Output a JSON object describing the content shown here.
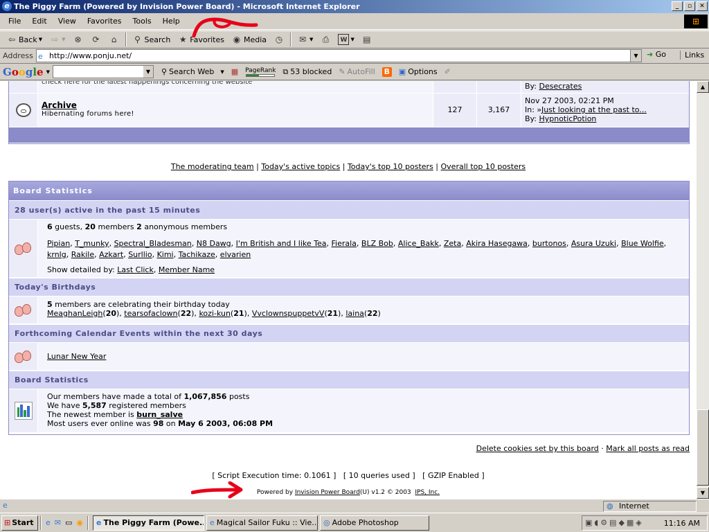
{
  "window": {
    "title": "The Piggy Farm (Powered by Invision Power Board) - Microsoft Internet Explorer",
    "minimize": "_",
    "maximize": "▫",
    "close": "✕"
  },
  "menu": [
    "File",
    "Edit",
    "View",
    "Favorites",
    "Tools",
    "Help"
  ],
  "toolbar": {
    "back": "Back",
    "search": "Search",
    "favorites": "Favorites",
    "media": "Media"
  },
  "address": {
    "label": "Address",
    "url": "http://www.ponju.net/",
    "go": "Go",
    "links": "Links"
  },
  "google_bar": {
    "logo": "Google",
    "search_web": "Search Web",
    "pagerank": "PageRank",
    "blocked": "53 blocked",
    "autofill": "AutoFill",
    "options": "Options"
  },
  "forum_top": {
    "cut_text": "check here for the latest happenings concerning the website",
    "by_label": "By:",
    "by_user": "Desecrates"
  },
  "archive": {
    "title": "Archive",
    "desc": "Hibernating forums here!",
    "topics": "127",
    "replies": "3,167",
    "date": "Nov 27 2003, 02:21 PM",
    "in_label": "In:",
    "in_topic": "Just looking at the past to...",
    "by_label": "By:",
    "by_user": "HypnoticPotion"
  },
  "center_links": {
    "moderating": "The moderating team",
    "active": "Today's active topics",
    "top_today": "Today's top 10 posters",
    "top_overall": "Overall top 10 posters",
    "sep": "|"
  },
  "stats": {
    "header": "Board Statistics",
    "active_head": "28 user(s) active in the past 15 minutes",
    "guests_n": "6",
    "guests_t": " guests, ",
    "members_n": "20",
    "members_t": " members ",
    "anon_n": "2",
    "anon_t": " anonymous members",
    "users": [
      "Pipian",
      "T_munky",
      "Spectral_Bladesman",
      "N8 Dawg",
      "I'm British and I like Tea",
      "Fierala",
      "BLZ Bob",
      "Alice_Bakk",
      "Zeta",
      "Akira Hasegawa",
      "burtonos",
      "Asura Uzuki",
      "Blue Wolfie",
      "krnlg",
      "Rakile",
      "Azkart",
      "Surllio",
      "Kimi",
      "Tachikaze",
      "elvarien"
    ],
    "detail_label": "Show detailed by: ",
    "last_click": "Last Click",
    "member_name": "Member Name",
    "birthday_head": "Today's Birthdays",
    "bday_n": "5",
    "bday_t": " members are celebrating their birthday today",
    "bdays": [
      {
        "name": "MeaghanLeigh",
        "age": "20"
      },
      {
        "name": "tearsofaclown",
        "age": "22"
      },
      {
        "name": "kozi-kun",
        "age": "21"
      },
      {
        "name": "VvclownspuppetvV",
        "age": "21"
      },
      {
        "name": "laina",
        "age": "22"
      }
    ],
    "calendar_head": "Forthcoming Calendar Events within the next 30 days",
    "event": "Lunar New Year",
    "board_head": "Board Statistics",
    "line1_a": "Our members have made a total of ",
    "line1_b": "1,067,856",
    "line1_c": " posts",
    "line2_a": "We have ",
    "line2_b": "5,587",
    "line2_c": " registered members",
    "line3_a": "The newest member is ",
    "line3_b": "burn_salve",
    "line4_a": "Most users ever online was ",
    "line4_b": "98",
    "line4_c": " on ",
    "line4_d": "May 6 2003, 06:08 PM"
  },
  "bottom": {
    "delete_cookies": "Delete cookies set by this board",
    "dot": " · ",
    "mark_read": "Mark all posts as read",
    "exec": "[ Script Execution time: 0.1061 ]   [ 10 queries used ]   [ GZIP Enabled ]",
    "powered_a": "Powered by ",
    "powered_link": "Invision Power Board",
    "powered_b": "(U) v1.2 © 2003  ",
    "ips": "IPS, Inc."
  },
  "status": {
    "zone": "Internet"
  },
  "taskbar": {
    "start": "Start",
    "tasks": [
      "The Piggy Farm (Powe...",
      "Magical Sailor Fuku :: Vie...",
      "Adobe Photoshop"
    ],
    "clock": "11:16 AM"
  },
  "colors": {
    "forum_border": "#8b8bc9",
    "subhead_bg": "#d3d3f3",
    "row_bg": "#f4f4fc",
    "annotation": "#e8001a"
  }
}
